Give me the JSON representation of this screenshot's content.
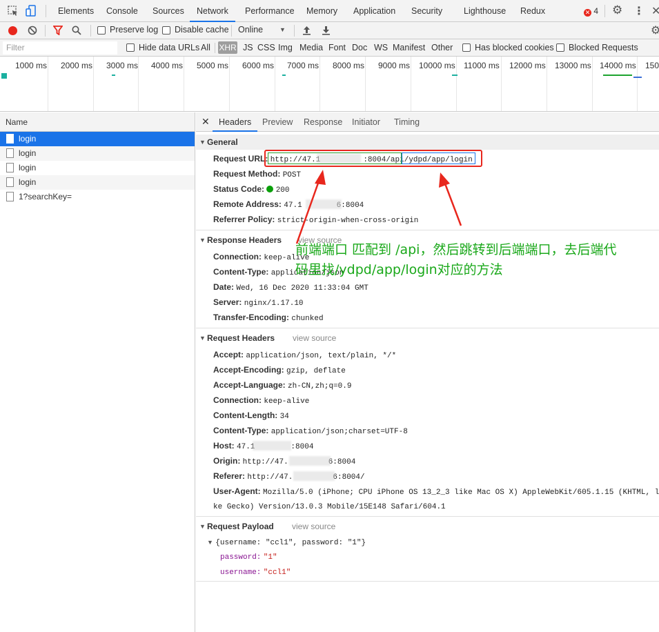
{
  "tabs": [
    "Elements",
    "Console",
    "Sources",
    "Network",
    "Performance",
    "Memory",
    "Application",
    "Security",
    "Lighthouse",
    "Redux"
  ],
  "active_tab": "Network",
  "error_count": "4",
  "toolbar": {
    "preserve_log": "Preserve log",
    "disable_cache": "Disable cache",
    "throttle": "Online"
  },
  "filter": {
    "placeholder": "Filter",
    "hide_data_urls": "Hide data URLs",
    "types": [
      "All",
      "XHR",
      "JS",
      "CSS",
      "Img",
      "Media",
      "Font",
      "Doc",
      "WS",
      "Manifest",
      "Other"
    ],
    "has_blocked_cookies": "Has blocked cookies",
    "blocked_requests": "Blocked Requests"
  },
  "timeline": {
    "ticks": [
      "1000 ms",
      "2000 ms",
      "3000 ms",
      "4000 ms",
      "5000 ms",
      "6000 ms",
      "7000 ms",
      "8000 ms",
      "9000 ms",
      "10000 ms",
      "11000 ms",
      "12000 ms",
      "13000 ms",
      "14000 ms",
      "150"
    ]
  },
  "requests": {
    "header": "Name",
    "items": [
      "login",
      "login",
      "login",
      "login",
      "1?searchKey="
    ]
  },
  "detail_tabs": [
    "Headers",
    "Preview",
    "Response",
    "Initiator",
    "Timing"
  ],
  "general": {
    "title": "General",
    "request_url_label": "Request URL:",
    "request_url_a": "http://47.1",
    "request_url_b": ":8004/api",
    "request_url_c": "/ydpd/app/login",
    "method_label": "Request Method:",
    "method": "POST",
    "status_label": "Status Code:",
    "status": "200",
    "remote_label": "Remote Address:",
    "remote_a": "47.1",
    "remote_b": "6:8004",
    "referrer_label": "Referrer Policy:",
    "referrer": "strict-origin-when-cross-origin"
  },
  "response_headers": {
    "title": "Response Headers",
    "view_source": "view source",
    "rows": [
      {
        "k": "Connection:",
        "v": "keep-alive"
      },
      {
        "k": "Content-Type:",
        "v": "application/json"
      },
      {
        "k": "Date:",
        "v": "Wed, 16 Dec 2020 11:33:04 GMT"
      },
      {
        "k": "Server:",
        "v": "nginx/1.17.10"
      },
      {
        "k": "Transfer-Encoding:",
        "v": "chunked"
      }
    ]
  },
  "request_headers": {
    "title": "Request Headers",
    "view_source": "view source",
    "rows": [
      {
        "k": "Accept:",
        "v": "application/json, text/plain, */*"
      },
      {
        "k": "Accept-Encoding:",
        "v": "gzip, deflate"
      },
      {
        "k": "Accept-Language:",
        "v": "zh-CN,zh;q=0.9"
      },
      {
        "k": "Connection:",
        "v": "keep-alive"
      },
      {
        "k": "Content-Length:",
        "v": "34"
      },
      {
        "k": "Content-Type:",
        "v": "application/json;charset=UTF-8"
      },
      {
        "k": "Host:",
        "v": "47.1"
      },
      {
        "k": "Origin:",
        "v": "http://47."
      },
      {
        "k": "Referer:",
        "v": "http://47."
      },
      {
        "k": "User-Agent:",
        "v": "Mozilla/5.0 (iPhone; CPU iPhone OS 13_2_3 like Mac OS X) AppleWebKit/605.1.15 (KHTML, l"
      }
    ],
    "host_tail": ":8004",
    "origin_tail": "6:8004",
    "referer_tail": "6:8004/",
    "ua_cont": "ke Gecko) Version/13.0.3 Mobile/15E148 Safari/604.1"
  },
  "payload": {
    "title": "Request Payload",
    "view_source": "view source",
    "summary": "{username: \"ccl1\", password: \"1\"}",
    "rows": [
      {
        "k": "password:",
        "v": "\"1\""
      },
      {
        "k": "username:",
        "v": "\"ccl1\""
      }
    ]
  },
  "annotation": {
    "line1": "前端端口 匹配到 /api，然后跳转到后端端口，去后端代",
    "line2": "码里找/ydpd/app/login对应的方法"
  },
  "colors": {
    "accent": "#1a73e8",
    "annotation_red": "#e8271d",
    "annotation_green": "#1aa81a",
    "status_green": "#0a9f0a",
    "record_red": "#e8271d"
  }
}
